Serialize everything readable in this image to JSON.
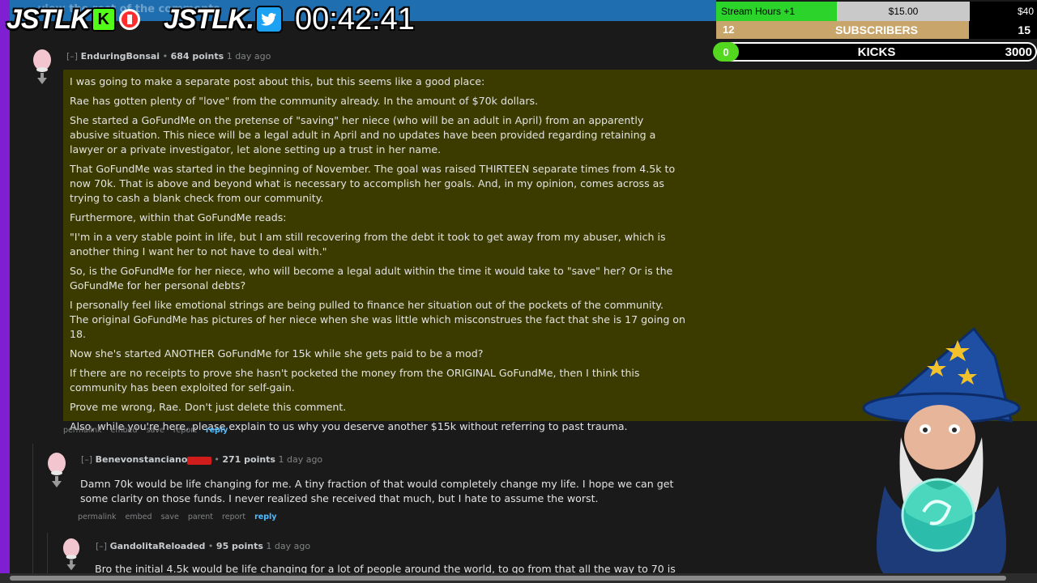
{
  "overlay": {
    "logo_text_1": "JSTLK",
    "kick_letter": "K",
    "logo_text_2": "JSTLK.",
    "timer": "00:42:41",
    "ghost_banner": "...view the rest of the comments",
    "stream_hours": {
      "label": "Stream Hours +1",
      "price": "$15.00",
      "max": "$40",
      "progress_fraction": 0.375
    },
    "subscribers": {
      "count": "12",
      "label": "SUBSCRIBERS",
      "max": "15",
      "progress_fraction": 0.8
    },
    "kicks": {
      "count": "0",
      "label": "KICKS",
      "max": "3000",
      "progress_fraction": 0.0
    }
  },
  "post": {
    "toggle": "[–]",
    "author": "EnduringBonsai",
    "points": "684 points",
    "age": "1 day ago",
    "paragraphs": [
      "I was going to make a separate post about this, but this seems like a good place:",
      "Rae has gotten plenty of \"love\" from the community already. In the amount of $70k dollars.",
      "She started a GoFundMe on the pretense of \"saving\" her niece (who will be an adult in April) from an apparently abusive situation. This niece will be a legal adult in April and no updates have been provided regarding retaining a lawyer or a private investigator, let alone setting up a trust in her name.",
      "That GoFundMe was started in the beginning of November. The goal was raised THIRTEEN separate times from 4.5k to now 70k. That is above and beyond what is necessary to accomplish her goals. And, in my opinion, comes across as trying to cash a blank check from our community.",
      "Furthermore, within that GoFundMe reads:",
      "\"I'm in a very stable point in life, but I am still recovering from the debt it took to get away from my abuser, which is another thing I want her to not have to deal with.\"",
      "So, is the GoFundMe for her niece, who will become a legal adult within the time it would take to \"save\" her? Or is the GoFundMe for her personal debts?",
      "I personally feel like emotional strings are being pulled to finance her situation out of the pockets of the community. The original GoFundMe has pictures of her niece when she was little which misconstrues the fact that she is 17 going on 18.",
      "Now she's started ANOTHER GoFundMe for 15k while she gets paid to be a mod?",
      "If there are no receipts to prove she hasn't pocketed the money from the ORIGINAL GoFundMe, then I think this community has been exploited for self-gain.",
      "Prove me wrong, Rae. Don't just delete this comment.",
      "Also, while you're here, please explain to us why you deserve another $15k without referring to past trauma."
    ],
    "actions": [
      "permalink",
      "embed",
      "save",
      "report",
      "reply"
    ]
  },
  "reply1": {
    "toggle": "[–]",
    "author": "Benevonstanciano",
    "flair": "flair",
    "points": "271 points",
    "age": "1 day ago",
    "text": "Damn 70k would be life changing for me. A tiny fraction of that would completely change my life. I hope we can get some clarity on those funds. I never realized she received that much, but I hate to assume the worst.",
    "actions": [
      "permalink",
      "embed",
      "save",
      "parent",
      "report",
      "reply"
    ]
  },
  "reply2": {
    "toggle": "[–]",
    "author": "GandolitaReloaded",
    "points": "95 points",
    "age": "1 day ago",
    "text": "Bro the initial 4.5k would be life changing for a lot of people around the world, to go from that all the way to 70 is"
  },
  "colors": {
    "kick_green": "#53fc18",
    "highlight_bg": "#3b3b00",
    "reply_blue": "#4fbcff",
    "subs_gold": "#c8a56a",
    "purple_strip": "#7f1fd1"
  },
  "icons": [
    "snoo-avatar-icon",
    "downvote-arrow-icon",
    "kick-icon",
    "record-icon",
    "twitter-icon",
    "wizard-avatar"
  ]
}
